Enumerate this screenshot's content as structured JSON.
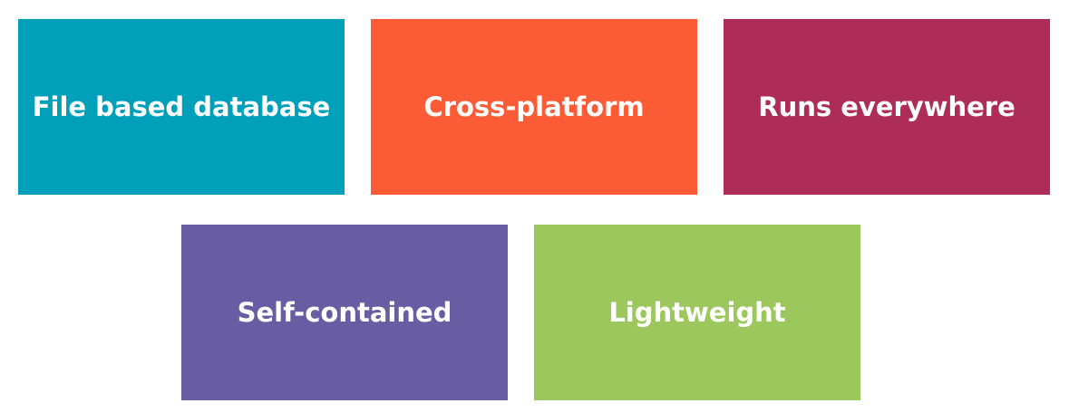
{
  "tiles": [
    {
      "label": "File based database",
      "color": "#00a0bb"
    },
    {
      "label": "Cross-platform",
      "color": "#fb5b35"
    },
    {
      "label": "Runs everywhere",
      "color": "#ad2d58"
    },
    {
      "label": "Self-contained",
      "color": "#685ca2"
    },
    {
      "label": "Lightweight",
      "color": "#9bc75c"
    }
  ]
}
